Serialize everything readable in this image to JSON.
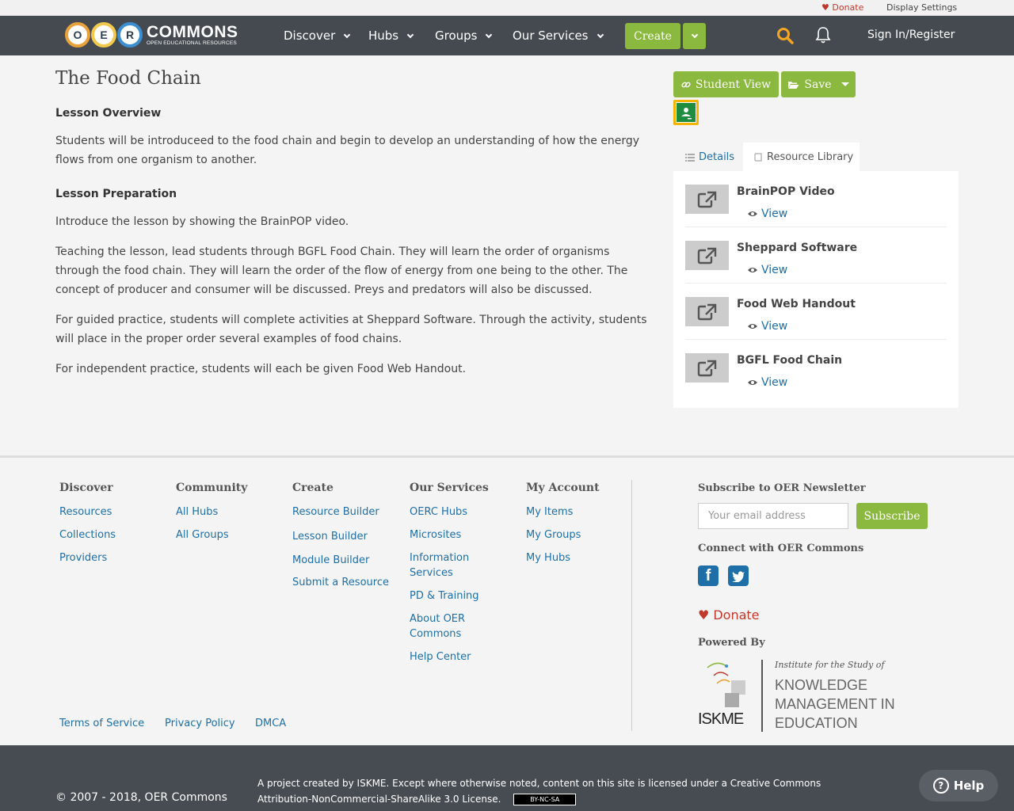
{
  "utility": {
    "donate": "Donate",
    "display_settings": "Display Settings"
  },
  "header": {
    "logo_letters": [
      "O",
      "E",
      "R"
    ],
    "logo_text": "COMMONS",
    "logo_subtext": "OPEN EDUCATIONAL RESOURCES",
    "nav": [
      "Discover",
      "Hubs",
      "Groups",
      "Our Services"
    ],
    "create_label": "Create",
    "signin_label": "Sign In/Register",
    "colors": {
      "bar": "#444a50",
      "accent_green": "#8bb83f",
      "search_icon": "#f5a623"
    }
  },
  "main": {
    "title": "The Food Chain",
    "overview_heading": "Lesson Overview",
    "overview_text": "Students will be introduceed to the food chain and begin to develop an understanding of how the energy flows from one organism to another.",
    "prep_heading": "Lesson Preparation",
    "prep_paragraphs": [
      "Introduce the lesson by showing the BrainPOP video.",
      "Teaching the lesson, lead students through BGFL Food Chain. They will learn the order of organisms through the food chain. They will learn the order of the flow of energy from one being to the other. The concept of producer and consumer will be discussed. Preys and predators will also be discussed.",
      "For guided practice, students will complete activities at Sheppard Software. Through the activity, students will place in the proper order several examples of food chains.",
      "For independent practice, students will each be given Food Web Handout."
    ]
  },
  "sidebar": {
    "student_view_label": "Student View",
    "save_label": "Save",
    "tabs": {
      "details": "Details",
      "library": "Resource Library"
    },
    "resources": [
      {
        "title": "BrainPOP Video",
        "action": "View"
      },
      {
        "title": "Sheppard Software",
        "action": "View"
      },
      {
        "title": "Food Web Handout",
        "action": "View"
      },
      {
        "title": "BGFL Food Chain",
        "action": "View"
      }
    ]
  },
  "footer": {
    "columns": [
      {
        "heading": "Discover",
        "links": [
          "Resources",
          "Collections",
          "Providers"
        ]
      },
      {
        "heading": "Community",
        "links": [
          "All Hubs",
          "All Groups"
        ]
      },
      {
        "heading": "Create",
        "links": [
          "Resource Builder",
          "Lesson Builder",
          "Module Builder",
          "Submit a Resource"
        ]
      },
      {
        "heading": "Our Services",
        "links": [
          "OERC Hubs",
          "Microsites",
          "Information Services",
          "PD & Training",
          "About OER Commons",
          "Help Center"
        ]
      },
      {
        "heading": "My Account",
        "links": [
          "My Items",
          "My Groups",
          "My Hubs"
        ]
      }
    ],
    "legal": [
      "Terms of Service",
      "Privacy Policy",
      "DMCA"
    ],
    "newsletter_heading": "Subscribe to OER Newsletter",
    "email_placeholder": "Your email address",
    "subscribe_label": "Subscribe",
    "connect_heading": "Connect with OER Commons",
    "donate_label": "Donate",
    "powered_by": "Powered By",
    "iskme": {
      "tagline": "Institute for the Study of",
      "lines": [
        "KNOWLEDGE",
        "MANAGEMENT IN",
        "EDUCATION"
      ],
      "wordmark": "ISKME"
    }
  },
  "bottom": {
    "copyright": "© 2007 - 2018, OER Commons",
    "license": "A project created by ISKME. Except where otherwise noted, content on this site is licensed under a Creative Commons Attribution-NonCommercial-ShareAlike 3.0 License.",
    "cc_badge": "BY-NC-SA",
    "help_label": "Help"
  }
}
